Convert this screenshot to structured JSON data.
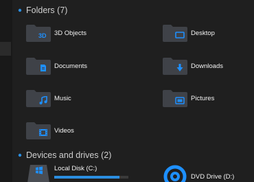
{
  "colors": {
    "accent": "#1e90ff",
    "folder": "#3f4248",
    "background": "#1f1f1f"
  },
  "folders_section": {
    "title": "Folders (7)",
    "chevron_icon": "chevron-down-icon"
  },
  "folders": [
    {
      "name": "3D Objects",
      "icon": "3d-objects-icon"
    },
    {
      "name": "Desktop",
      "icon": "desktop-icon"
    },
    {
      "name": "Documents",
      "icon": "document-icon"
    },
    {
      "name": "Downloads",
      "icon": "download-arrow-icon"
    },
    {
      "name": "Music",
      "icon": "music-note-icon"
    },
    {
      "name": "Pictures",
      "icon": "picture-icon"
    },
    {
      "name": "Videos",
      "icon": "film-icon"
    }
  ],
  "drives_section": {
    "title": "Devices and drives (2)",
    "chevron_icon": "chevron-down-icon"
  },
  "drives": [
    {
      "name": "Local Disk (C:)",
      "icon": "windows-drive-icon",
      "used_fraction": 0.88
    },
    {
      "name": "DVD Drive (D:)",
      "icon": "dvd-disc-icon"
    }
  ]
}
